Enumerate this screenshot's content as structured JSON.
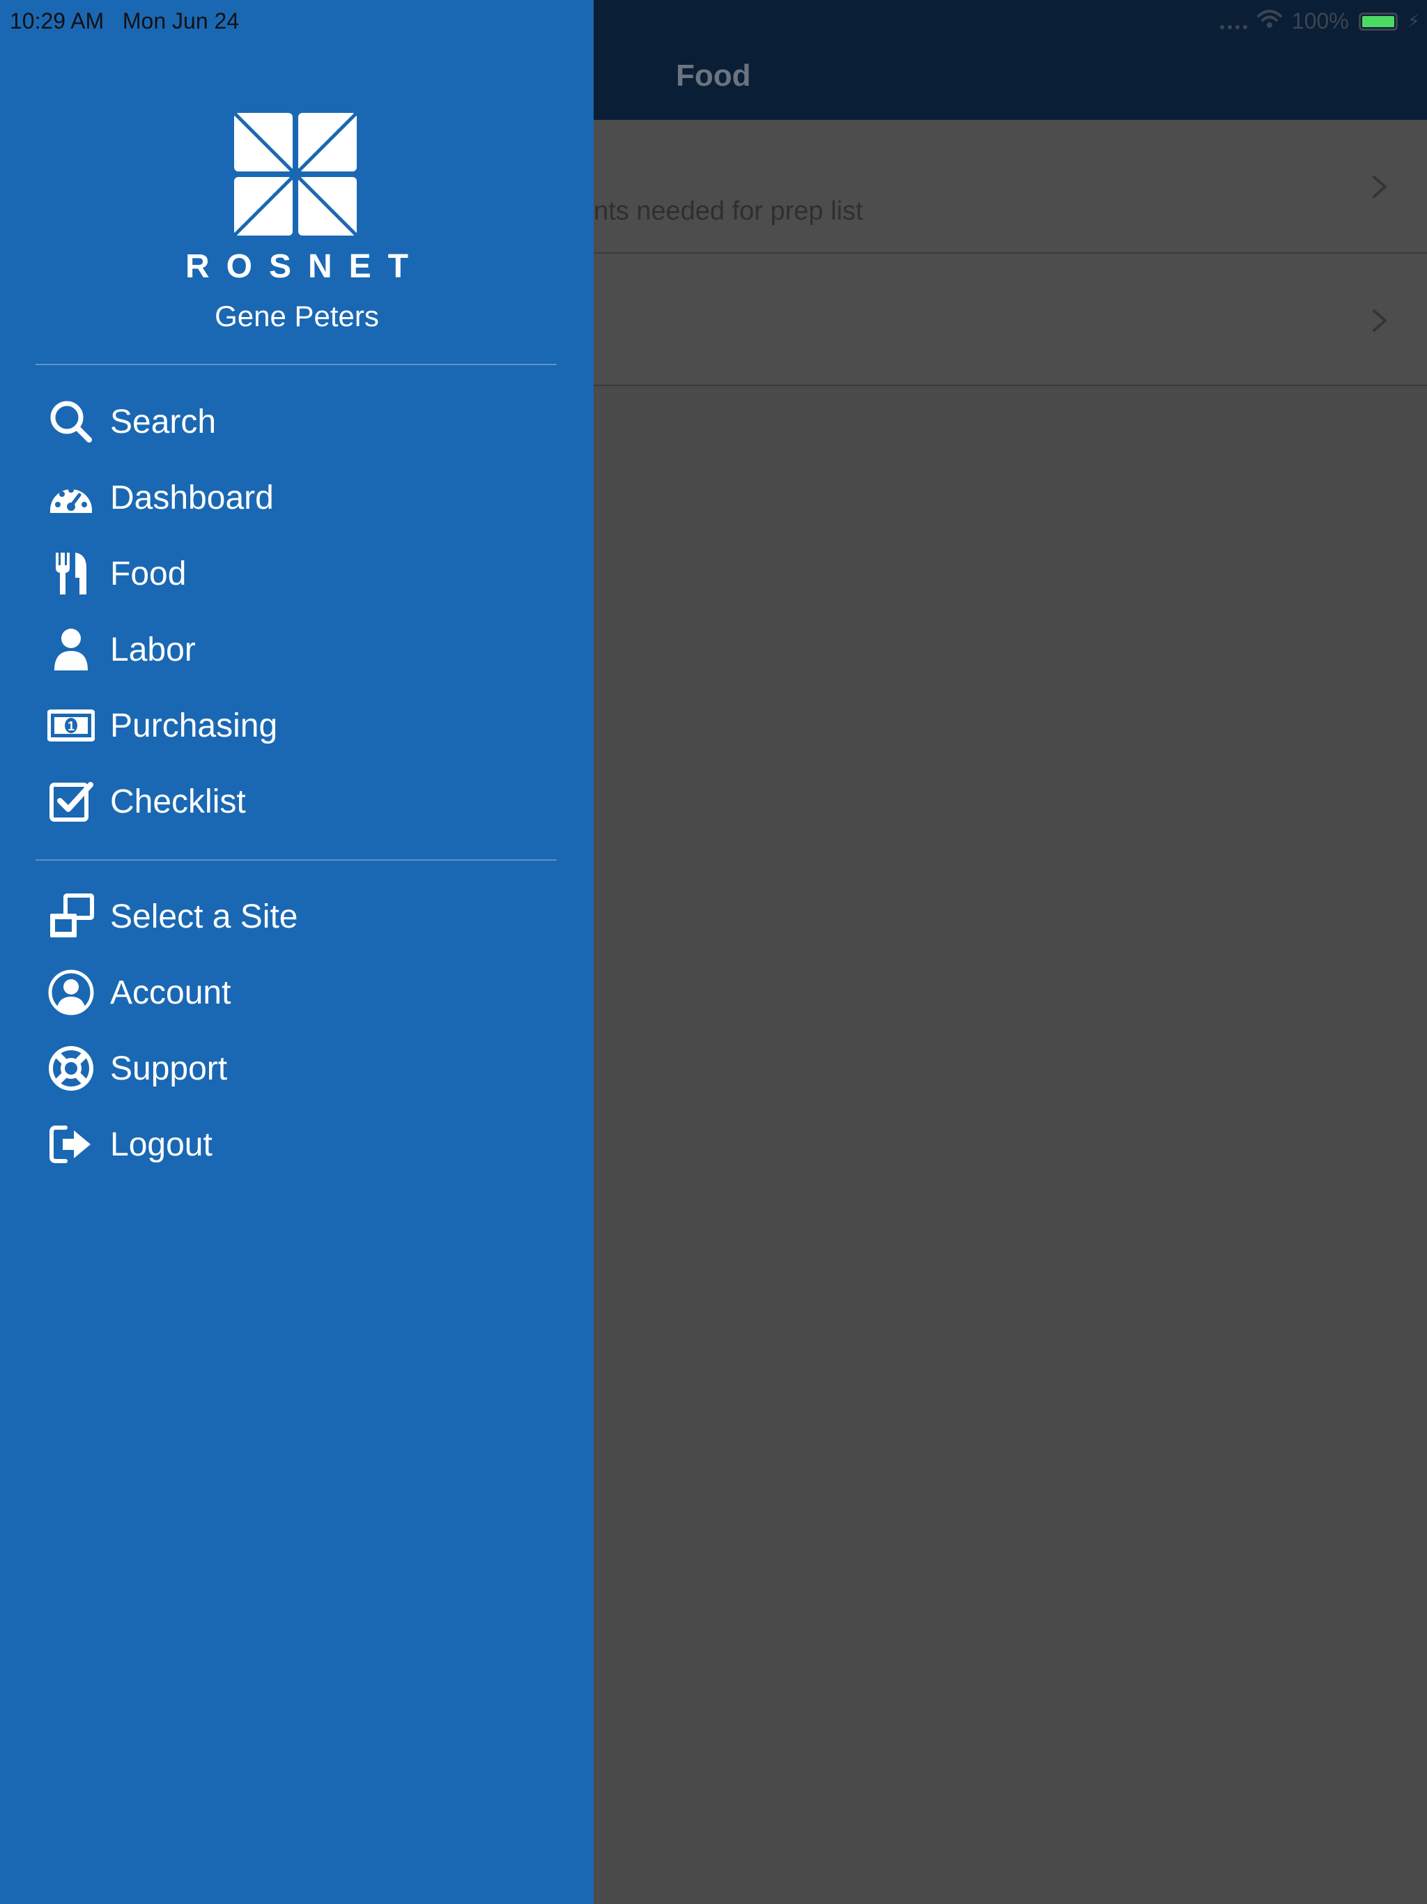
{
  "status_bar": {
    "time": "10:29 AM",
    "date": "Mon Jun 24",
    "battery": "100%",
    "battery_level": 1.0
  },
  "background": {
    "nav_title": "Food",
    "rows": [
      {
        "text": "nts needed for prep list"
      },
      {
        "text": ""
      }
    ]
  },
  "drawer": {
    "brand": "ROSNET",
    "user_name": "Gene Peters",
    "primary_items": [
      {
        "label": "Search",
        "icon": "search-icon"
      },
      {
        "label": "Dashboard",
        "icon": "dashboard-icon"
      },
      {
        "label": "Food",
        "icon": "fork-knife-icon"
      },
      {
        "label": "Labor",
        "icon": "person-icon"
      },
      {
        "label": "Purchasing",
        "icon": "money-icon"
      },
      {
        "label": "Checklist",
        "icon": "checklist-icon"
      }
    ],
    "secondary_items": [
      {
        "label": "Select a Site",
        "icon": "select-site-icon"
      },
      {
        "label": "Account",
        "icon": "account-icon"
      },
      {
        "label": "Support",
        "icon": "support-icon"
      },
      {
        "label": "Logout",
        "icon": "logout-icon"
      }
    ]
  },
  "colors": {
    "drawer": "#1a68b3",
    "overlay": "#4b4b4b",
    "navbar": "#0a1e36",
    "battery": "#4cd964"
  }
}
